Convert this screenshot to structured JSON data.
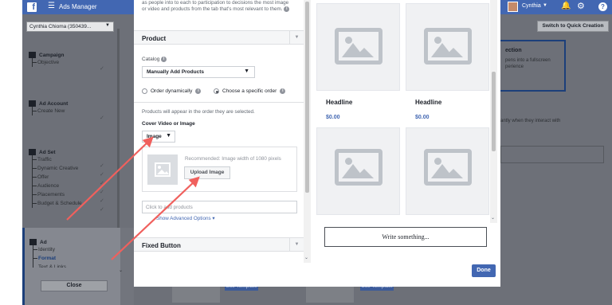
{
  "app": {
    "title": "Ads Manager",
    "user_name": "Cynthia"
  },
  "sidebar": {
    "account": "Cynthia Chioma (350439...",
    "sections": [
      {
        "title": "Campaign",
        "items": [
          "Objective"
        ]
      },
      {
        "title": "Ad Account",
        "items": [
          "Create New"
        ]
      },
      {
        "title": "Ad Set",
        "items": [
          "Traffic",
          "Dynamic Creative",
          "Offer",
          "Audience",
          "Placements",
          "Budget & Schedule"
        ]
      },
      {
        "title": "Ad",
        "items": [
          "Identity",
          "Format",
          "Text & Links"
        ]
      }
    ],
    "close_label": "Close"
  },
  "editor": {
    "intro": "as people into to each to participation to decisions the most image or video and products from the tab that's most relevant to them.",
    "product_section": "Product",
    "catalog_label": "Catalog",
    "catalog_value": "Manually Add Products",
    "radio_dynamic": "Order dynamically",
    "radio_specific": "Choose a specific order",
    "selected_order": "Choose a specific order",
    "order_note": "Products will appear in the order they are selected.",
    "cover_label": "Cover Video or Image",
    "cover_value": "Image",
    "recommendation": "Recommended: Image width of 1080 pixels",
    "upload_label": "Upload Image",
    "add_placeholder": "Click to add products",
    "advanced_link": "Show Advanced Options ▾",
    "fixed_section": "Fixed Button"
  },
  "preview": {
    "cards": [
      {
        "headline": "Headline",
        "price": "$0.00"
      },
      {
        "headline": "Headline",
        "price": "$0.00"
      }
    ],
    "write_placeholder": "Write something..."
  },
  "modal": {
    "done_label": "Done"
  },
  "right_panel": {
    "quick_label": "Switch to Quick Creation",
    "collection_title": "ection",
    "collection_desc": "pens into a fullscreen perience",
    "interaction_text": "antly when they interact with"
  },
  "templates": {
    "use_label": "Use Template"
  },
  "colors": {
    "brand": "#4267b2",
    "annotation_arrow": "#f0605d"
  }
}
